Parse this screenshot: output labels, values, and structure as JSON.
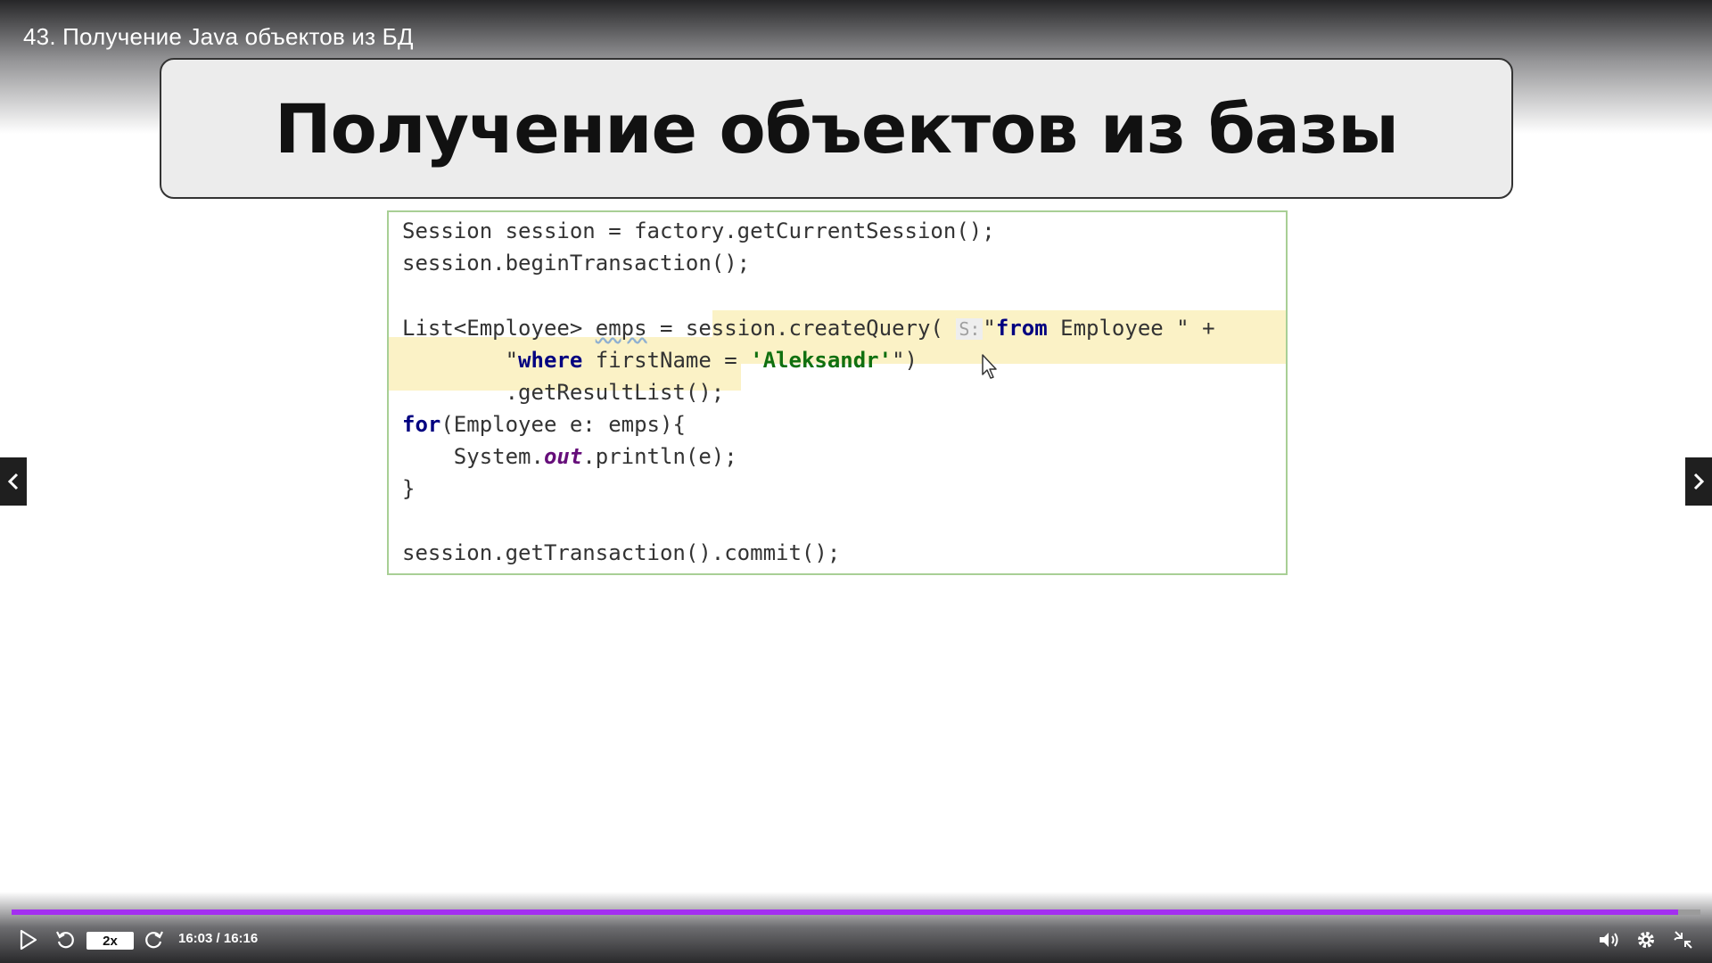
{
  "video": {
    "title": "43. Получение Java объектов из БД"
  },
  "slide": {
    "title": "Получение объектов из базы",
    "code": {
      "line1": "Session session = factory.getCurrentSession();",
      "line2": "session.beginTransaction();",
      "line4_pre": "List<Employee> ",
      "line4_var": "emps",
      "line4_mid": " = session.createQuery( ",
      "line4_hint": "S:",
      "line4_q": "\"",
      "line4_kw": "from",
      "line4_rest": " Employee \" +",
      "line5_indent": "        ",
      "line5_q": "\"",
      "line5_kw": "where",
      "line5_mid": " firstName = ",
      "line5_str": "'Aleksandr'",
      "line5_end": "\")",
      "line6": "        .getResultList();",
      "line7_kw": "for",
      "line7_rest": "(Employee e: emps){",
      "line8_pre": "    System.",
      "line8_fld": "out",
      "line8_post": ".println(e);",
      "line9": "}",
      "line11": "session.getTransaction().commit();"
    }
  },
  "player": {
    "speed": "2x",
    "time": "16:03 / 16:16",
    "progress": 0.9867,
    "accent_color": "#a32ff0",
    "icons": [
      "play-icon",
      "rewind-icon",
      "forward-icon",
      "volume-icon",
      "settings-icon",
      "exit-fullscreen-icon",
      "prev-arrow-icon",
      "next-arrow-icon"
    ]
  }
}
